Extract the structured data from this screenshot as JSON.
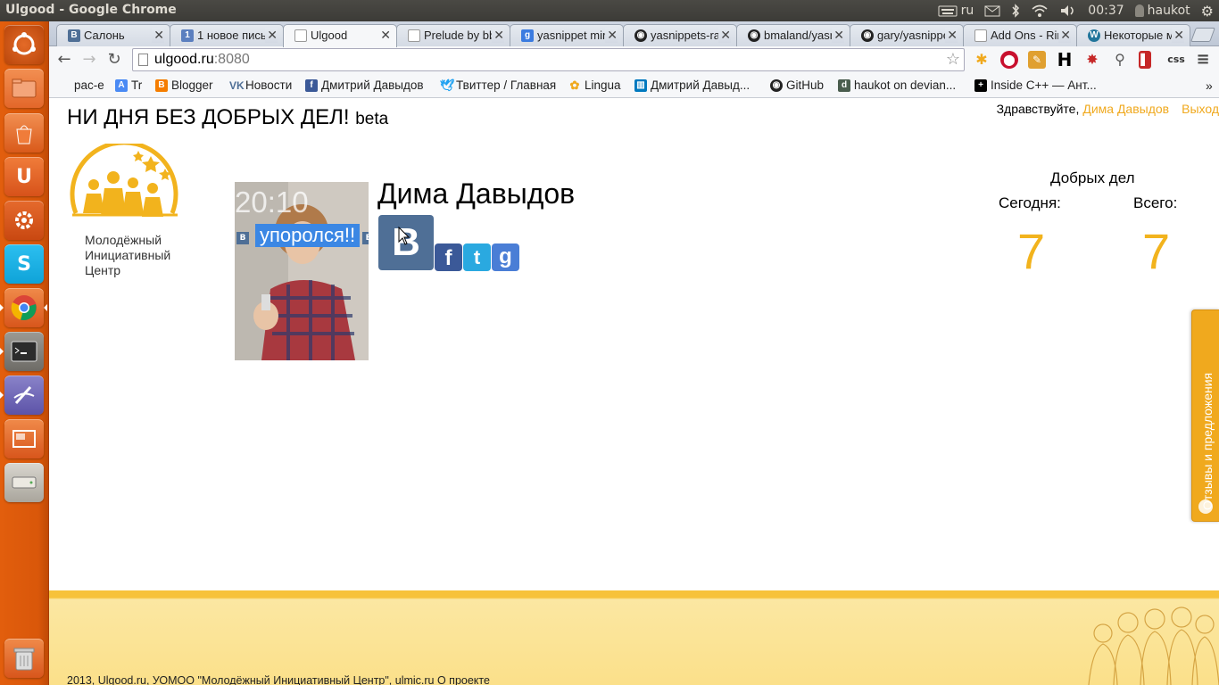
{
  "os_panel": {
    "window_title": "Ulgood - Google Chrome",
    "keyboard_layout": "ru",
    "time": "00:37",
    "user": "haukot"
  },
  "launcher": {
    "apps": [
      "ubuntu-dash",
      "files",
      "software-center",
      "ubuntu-one",
      "system-settings",
      "skype",
      "chrome",
      "terminal",
      "text-editor",
      "workspaces",
      "disk"
    ]
  },
  "tabs": [
    {
      "label": "Салонь",
      "icon": "vk",
      "color": "#4f6f96"
    },
    {
      "label": "1 новое пись",
      "icon": "mail",
      "color": "#2a5ea8"
    },
    {
      "label": "Ulgood",
      "icon": "page",
      "color": "#999999"
    },
    {
      "label": "Prelude by bb",
      "icon": "page",
      "color": "#999999"
    },
    {
      "label": "yasnippet mir",
      "icon": "google",
      "color": "#3b7be0"
    },
    {
      "label": "yasnippets-ra",
      "icon": "github",
      "color": "#222222"
    },
    {
      "label": "bmaland/yasr",
      "icon": "github",
      "color": "#222222"
    },
    {
      "label": "gary/yasnippe",
      "icon": "github",
      "color": "#222222"
    },
    {
      "label": "Add Ons - Rin",
      "icon": "page",
      "color": "#999999"
    },
    {
      "label": "Некоторые м",
      "icon": "wordpress",
      "color": "#21759b"
    }
  ],
  "toolbar": {
    "url_host": "ulgood.ru",
    "url_port": ":8080"
  },
  "bookmarks": [
    {
      "label": "рас-е",
      "icon": "folder",
      "color": "#ffffff"
    },
    {
      "label": "Tr",
      "icon": "translate",
      "color": "#4a8af4"
    },
    {
      "label": "Blogger",
      "icon": "blogger",
      "color": "#f57d00"
    },
    {
      "label": "Новости",
      "icon": "vk",
      "color": "#4f6f96"
    },
    {
      "label": "Дмитрий Давыдов",
      "icon": "facebook",
      "color": "#3b5998"
    },
    {
      "label": "Твиттер / Главная",
      "icon": "twitter",
      "color": "#1da1f2"
    },
    {
      "label": "Lingua",
      "icon": "lingua",
      "color": "#f0a91e"
    },
    {
      "label": "Дмитрий Давыд...",
      "icon": "trello",
      "color": "#0079bf"
    },
    {
      "label": "GitHub",
      "icon": "github",
      "color": "#222222"
    },
    {
      "label": "haukot on devian...",
      "icon": "deviantart",
      "color": "#4a5d4e"
    },
    {
      "label": "Inside C++ — Ант...",
      "icon": "cpp",
      "color": "#000000"
    }
  ],
  "page": {
    "title": "НИ ДНЯ БЕЗ ДОБРЫХ ДЕЛ!",
    "title_badge": "beta",
    "greeting": "Здравствуйте,",
    "user_name": "Дима Давыдов",
    "logout": "Выход",
    "logo_lines": [
      "Молодёжный",
      "Инициативный",
      "Центр"
    ],
    "photo_time": "20:10",
    "photo_caption": "упоролся!!",
    "person_name": "Дима Давыдов",
    "social": [
      "vk",
      "facebook",
      "twitter",
      "google"
    ],
    "stats_title": "Добрых дел",
    "stats_today_label": "Сегодня:",
    "stats_total_label": "Всего:",
    "stats_today": "7",
    "stats_total": "7",
    "feedback": "Отзывы и предложения",
    "footer": "2013, Ulgood.ru, УОМОО \"Молодёжный Инициативный Центр\", ulmic.ru О проекте"
  },
  "colors": {
    "accent": "#f0a91e",
    "footer": "#fbe08a",
    "launcher": "#e25e0d"
  }
}
